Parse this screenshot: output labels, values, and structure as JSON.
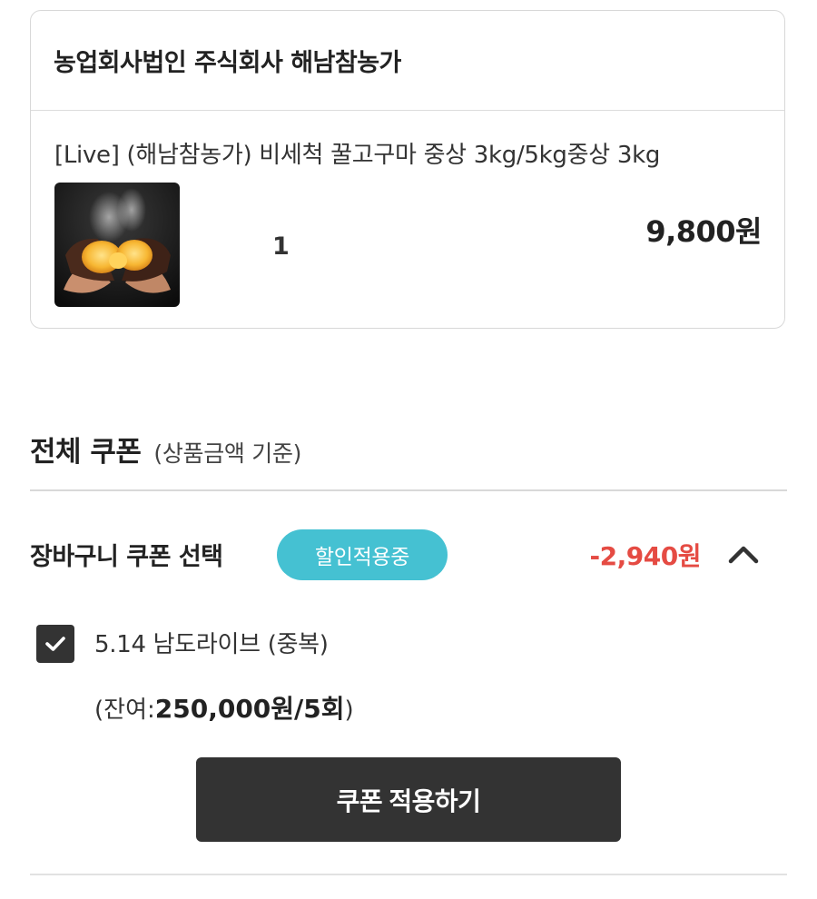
{
  "seller": {
    "name": "농업회사법인 주식회사 해남참농가"
  },
  "product": {
    "title": "[Live] (해남참농가) 비세척 꿀고구마 중상 3kg/5kg중상 3kg",
    "quantity": "1",
    "price": "9,800원",
    "thumbnail_icon": "roasted-sweet-potato-image"
  },
  "coupon_section": {
    "heading": "전체 쿠폰",
    "subheading": "(상품금액 기준)"
  },
  "cart_coupon": {
    "label": "장바구니 쿠폰 선택",
    "badge": "할인적용중",
    "discount": "-2,940원",
    "toggle_icon": "chevron-up-icon"
  },
  "coupon_item": {
    "checked": true,
    "name": "5.14 남도라이브 (중복)",
    "remaining_prefix": "(잔여:",
    "remaining_value": "250,000원/5회",
    "remaining_suffix": ")"
  },
  "apply_button": {
    "label": "쿠폰 적용하기"
  },
  "colors": {
    "badge": "#45c1d2",
    "discount": "#e54b43",
    "button": "#333333"
  }
}
